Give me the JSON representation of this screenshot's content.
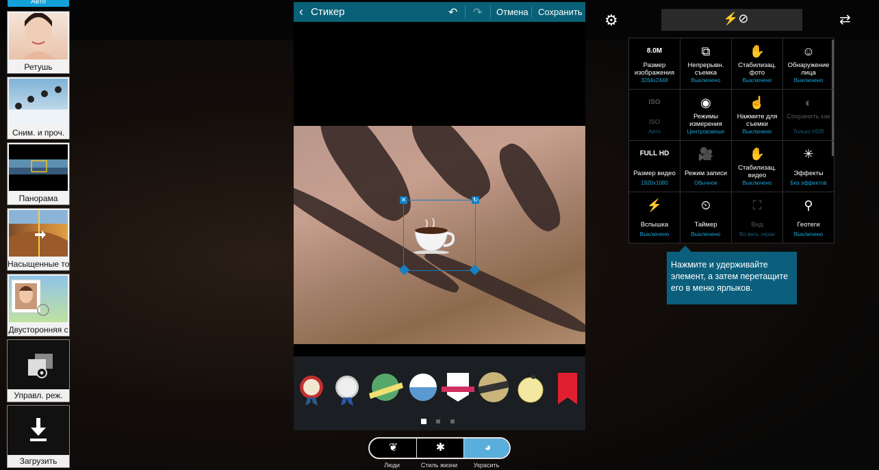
{
  "modes": {
    "auto_label": "Авто",
    "items": [
      {
        "label": "Ретушь",
        "icon": "beauty-face-thumb"
      },
      {
        "label": "Сним. и проч.",
        "icon": "shot-and-more-thumb"
      },
      {
        "label": "Панорама",
        "icon": "panorama-thumb"
      },
      {
        "label": "Насыщенные то",
        "icon": "rich-tone-thumb"
      },
      {
        "label": "Двусторонняя с",
        "icon": "dual-camera-thumb"
      },
      {
        "label": "Управл. реж.",
        "icon": "manage-modes-icon"
      },
      {
        "label": "Загрузить",
        "icon": "download-icon"
      }
    ]
  },
  "editor": {
    "title": "Стикер",
    "cancel_label": "Отмена",
    "save_label": "Сохранить",
    "sticker": "coffee-cup-sticker",
    "tray_page": 1,
    "tray_pages": 3
  },
  "categories": {
    "items": [
      {
        "label": "Люди",
        "icon": "people-icon"
      },
      {
        "label": "Стиль жизни",
        "icon": "lifestyle-icon"
      },
      {
        "label": "Украсить",
        "icon": "decorate-icon"
      }
    ],
    "active": 2
  },
  "settings": {
    "cells": [
      {
        "icon_text": "8.0M",
        "name": "Размер изображения",
        "value": "3264x2448",
        "dim": false
      },
      {
        "icon_text": "⧉",
        "name": "Непрерывн. съемка",
        "value": "Выключено",
        "dim": false
      },
      {
        "icon_text": "✋",
        "name": "Стабилизац. фото",
        "value": "Выключено",
        "dim": false
      },
      {
        "icon_text": "☺",
        "name": "Обнаружение лица",
        "value": "Выключено",
        "dim": false
      },
      {
        "icon_text": "ISO",
        "name": "ISO",
        "value": "Авто",
        "dim": true
      },
      {
        "icon_text": "◉",
        "name": "Режимы измерения",
        "value": "Центровзвеше",
        "dim": false
      },
      {
        "icon_text": "☝",
        "name": "Нажмите для съемки",
        "value": "Выключено",
        "dim": false
      },
      {
        "icon_text": "◐",
        "name": "Сохранить как",
        "value": "Только HDR",
        "dim": true
      },
      {
        "icon_text": "FULL HD",
        "name": "Размер видео",
        "value": "1920x1080",
        "dim": false
      },
      {
        "icon_text": "🎥",
        "name": "Режим записи",
        "value": "Обычное",
        "dim": false
      },
      {
        "icon_text": "✋",
        "name": "Стабилизац. видео",
        "value": "Выключено",
        "dim": false
      },
      {
        "icon_text": "✳",
        "name": "Эффекты",
        "value": "Без эффектов",
        "dim": false
      },
      {
        "icon_text": "⚡",
        "name": "Вспышка",
        "value": "Выключено",
        "dim": false
      },
      {
        "icon_text": "⏲",
        "name": "Таймер",
        "value": "Выключено",
        "dim": false
      },
      {
        "icon_text": "⛶",
        "name": "Вид",
        "value": "Во весь экран",
        "dim": true
      },
      {
        "icon_text": "⚲",
        "name": "Геотеги",
        "value": "Выключено",
        "dim": false
      }
    ]
  },
  "tooltip": "Нажмите и удерживайте элемент, а затем перетащите его в меню ярлыков."
}
